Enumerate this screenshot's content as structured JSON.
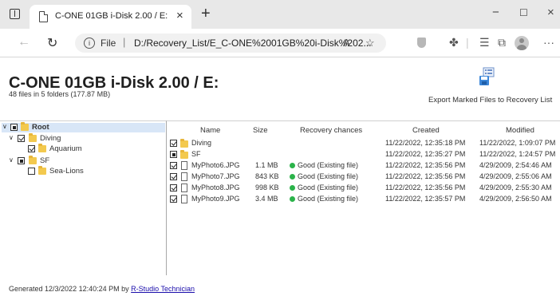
{
  "browser": {
    "tab_title": "C-ONE 01GB i-Disk 2.00 / E:",
    "address_label": "File",
    "url": "D:/Recovery_List/E_C-ONE%2001GB%20i-Disk%202..."
  },
  "report": {
    "title": "C-ONE 01GB i-Disk 2.00 / E:",
    "summary": "48 files in 5 folders (177.87 MB)",
    "export_label": "Export Marked Files to Recovery List"
  },
  "tree": [
    {
      "label": "Root",
      "state": "partial",
      "expanded": true,
      "level": 0,
      "selected": true
    },
    {
      "label": "Diving",
      "state": "checked",
      "expanded": true,
      "level": 1,
      "selected": false
    },
    {
      "label": "Aquarium",
      "state": "checked",
      "expanded": false,
      "level": 2,
      "selected": false
    },
    {
      "label": "SF",
      "state": "partial",
      "expanded": true,
      "level": 1,
      "selected": false
    },
    {
      "label": "Sea-Lions",
      "state": "unchecked",
      "expanded": false,
      "level": 2,
      "selected": false
    }
  ],
  "columns": {
    "name": "Name",
    "size": "Size",
    "recovery": "Recovery chances",
    "created": "Created",
    "modified": "Modified"
  },
  "files": [
    {
      "name": "Diving",
      "type": "folder",
      "state": "checked",
      "size": "",
      "recovery": "",
      "created": "11/22/2022, 12:35:18 PM",
      "modified": "11/22/2022, 1:09:07 PM"
    },
    {
      "name": "SF",
      "type": "folder",
      "state": "partial",
      "size": "",
      "recovery": "",
      "created": "11/22/2022, 12:35:27 PM",
      "modified": "11/22/2022, 1:24:57 PM"
    },
    {
      "name": "MyPhoto6.JPG",
      "type": "file",
      "state": "checked",
      "size": "1.1 MB",
      "recovery": "Good (Existing file)",
      "created": "11/22/2022, 12:35:56 PM",
      "modified": "4/29/2009, 2:54:46 AM"
    },
    {
      "name": "MyPhoto7.JPG",
      "type": "file",
      "state": "checked",
      "size": "843 KB",
      "recovery": "Good (Existing file)",
      "created": "11/22/2022, 12:35:56 PM",
      "modified": "4/29/2009, 2:55:06 AM"
    },
    {
      "name": "MyPhoto8.JPG",
      "type": "file",
      "state": "checked",
      "size": "998 KB",
      "recovery": "Good (Existing file)",
      "created": "11/22/2022, 12:35:56 PM",
      "modified": "4/29/2009, 2:55:30 AM"
    },
    {
      "name": "MyPhoto9.JPG",
      "type": "file",
      "state": "checked",
      "size": "3.4 MB",
      "recovery": "Good (Existing file)",
      "created": "11/22/2022, 12:35:57 PM",
      "modified": "4/29/2009, 2:56:50 AM"
    }
  ],
  "colors": {
    "good": "#2bb34a",
    "selection": "#d8e6f7",
    "folder": "#f3c94e",
    "link": "#1a0dab"
  },
  "footer": {
    "prefix": "Generated 12/3/2022 12:40:24 PM by",
    "link": "R-Studio Technician"
  }
}
